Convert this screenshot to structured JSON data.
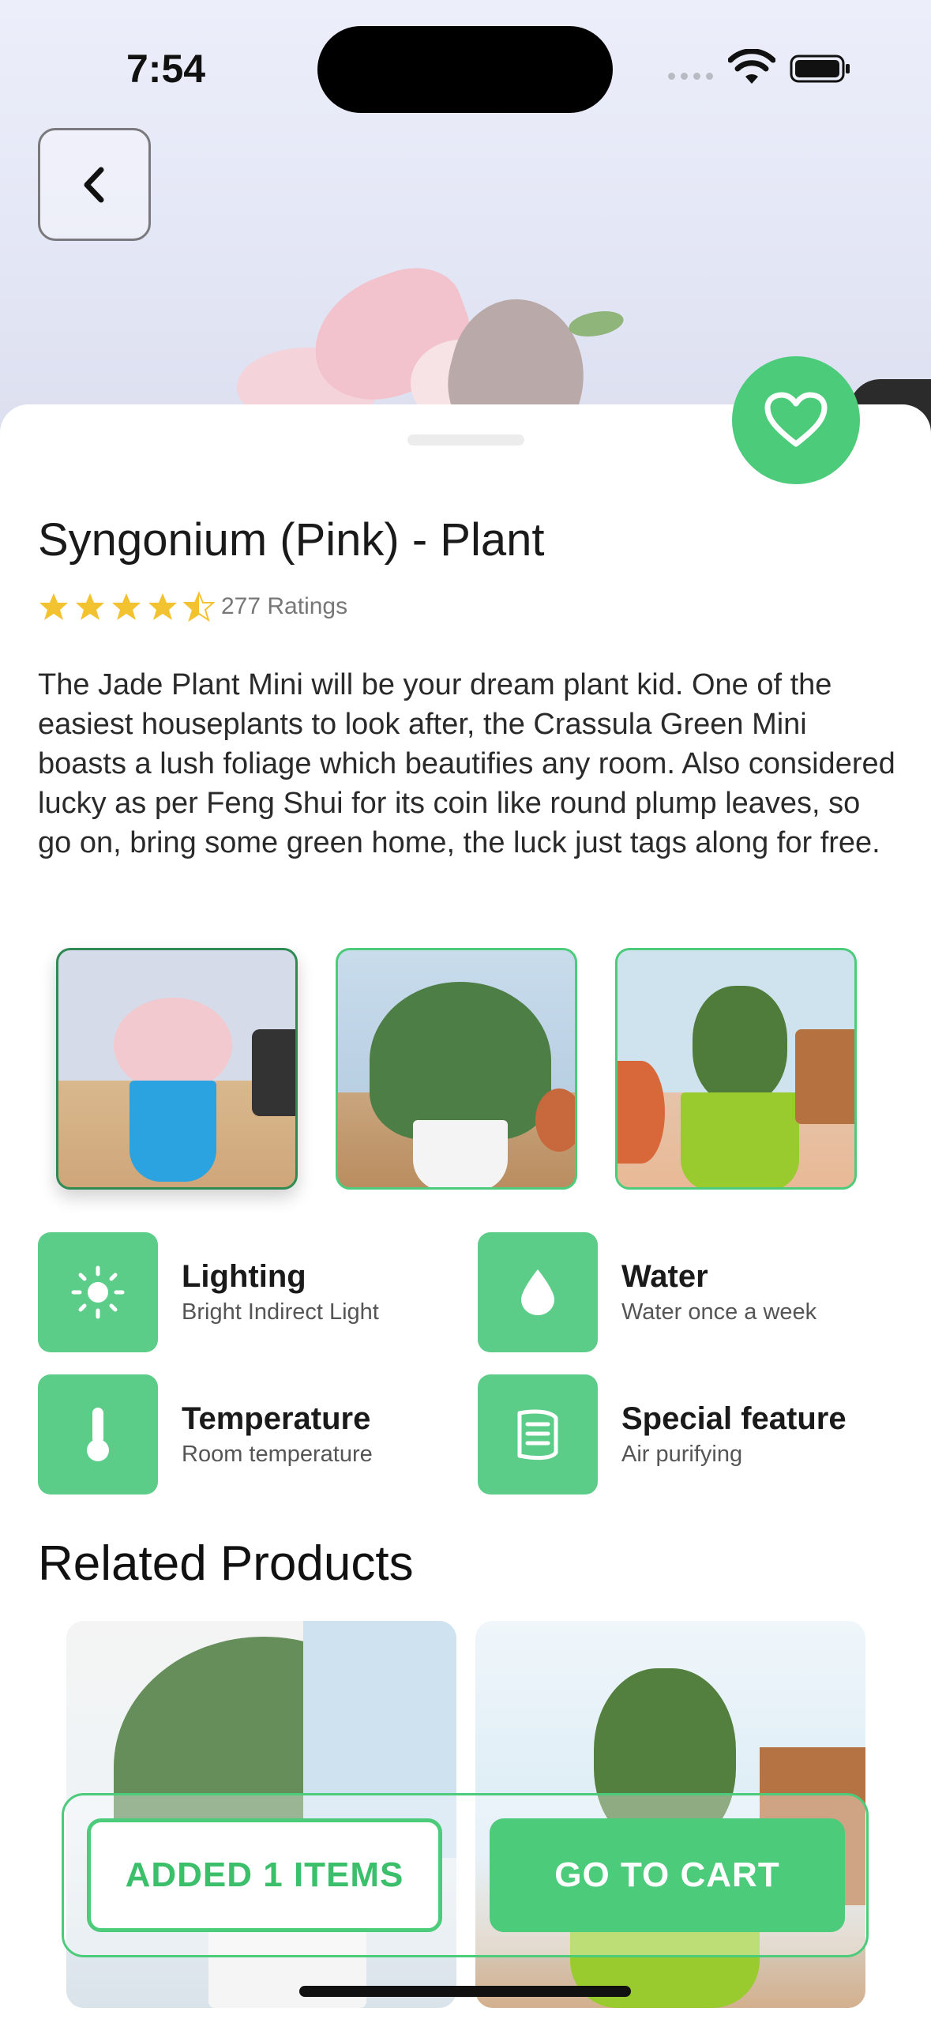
{
  "status_bar": {
    "time": "7:54"
  },
  "product": {
    "title": "Syngonium (Pink) - Plant",
    "rating": 4.5,
    "ratings_label": "277 Ratings",
    "description": "The Jade Plant Mini will be your dream plant kid. One of the easiest houseplants to look after, the Crassula Green Mini boasts a lush foliage which beautifies any room. Also considered lucky as per Feng Shui for its coin like round plump leaves, so go on, bring some green home, the luck just tags along for free."
  },
  "care": [
    {
      "title": "Lighting",
      "value": "Bright Indirect Light",
      "icon": "sun-icon"
    },
    {
      "title": "Water",
      "value": "Water once a week",
      "icon": "water-drop-icon"
    },
    {
      "title": "Temperature",
      "value": "Room temperature",
      "icon": "thermometer-icon"
    },
    {
      "title": "Special feature",
      "value": "Air purifying",
      "icon": "leaf-filter-icon"
    }
  ],
  "related": {
    "heading": "Related Products"
  },
  "cart": {
    "added_label": "ADDED 1 ITEMS",
    "go_label": "GO TO CART"
  },
  "colors": {
    "accent": "#4ccb7a",
    "star": "#f2c230"
  }
}
